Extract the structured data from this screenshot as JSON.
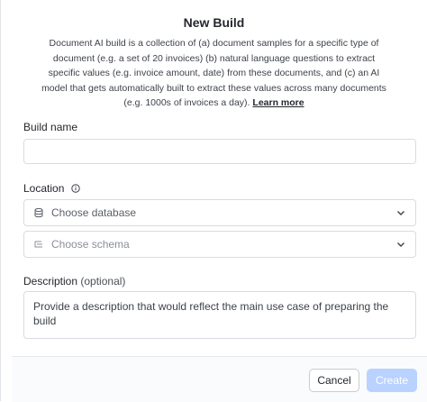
{
  "dialog": {
    "title": "New Build",
    "description": "Document AI build is a collection of (a) document samples for a specific type of document (e.g. a set of 20 invoices) (b) natural language questions to extract specific values (e.g. invoice amount, date) from these documents, and (c) an AI model that gets automatically built to extract these values across many documents (e.g. 1000s of invoices a day).",
    "learn_more": "Learn more"
  },
  "build_name": {
    "label": "Build name",
    "value": ""
  },
  "location": {
    "label": "Location",
    "info_icon": "info-icon",
    "database_placeholder": "Choose database",
    "database_icon": "database-icon",
    "schema_placeholder": "Choose schema",
    "schema_icon": "schema-icon"
  },
  "description_field": {
    "label": "Description",
    "label_optional": "(optional)",
    "placeholder": "Provide a description that would reflect the main use case of preparing the build"
  },
  "footer": {
    "cancel_label": "Cancel",
    "create_label": "Create"
  },
  "colors": {
    "primary_disabled": "#b9d2ff",
    "border": "#d8dbe0"
  }
}
